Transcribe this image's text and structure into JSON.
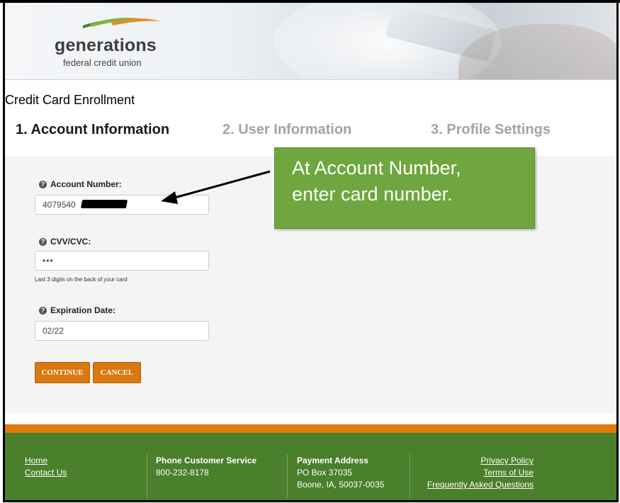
{
  "brand": {
    "name": "generations",
    "tagline": "federal credit union"
  },
  "page_title": "Credit Card Enrollment",
  "steps": [
    {
      "label": "1.  Account Information",
      "active": true
    },
    {
      "label": "2.  User Information",
      "active": false
    },
    {
      "label": "3.  Profile Settings",
      "active": false
    }
  ],
  "form": {
    "account_number": {
      "label": "Account Number:",
      "value": "4079540"
    },
    "cvv": {
      "label": "CVV/CVC:",
      "value": "•••",
      "hint": "Last 3 digits on the back of your card"
    },
    "expiration": {
      "label": "Expiration Date:",
      "value": "02/22"
    },
    "continue_label": "CONTINUE",
    "cancel_label": "CANCEL",
    "help_glyph": "?"
  },
  "callout": {
    "line1": "At Account Number,",
    "line2": "enter card number."
  },
  "footer": {
    "links_left": [
      "Home",
      "Contact Us"
    ],
    "phone_title": "Phone Customer Service",
    "phone_number": "800-232-8178",
    "payment_title": "Payment Address",
    "payment_line1": "PO Box 37035",
    "payment_line2": "Boone, IA, 50037-0035",
    "links_right": [
      "Privacy Policy",
      "Terms of Use",
      "Frequently Asked Questions"
    ]
  },
  "colors": {
    "accent_orange": "#d9780f",
    "footer_green": "#4a7f2b",
    "callout_green": "#6fa63f",
    "inactive_step": "#a3a3a3"
  },
  "icons": {
    "help": "question-circle-icon",
    "logo_mark": "swoosh-logo-icon"
  }
}
